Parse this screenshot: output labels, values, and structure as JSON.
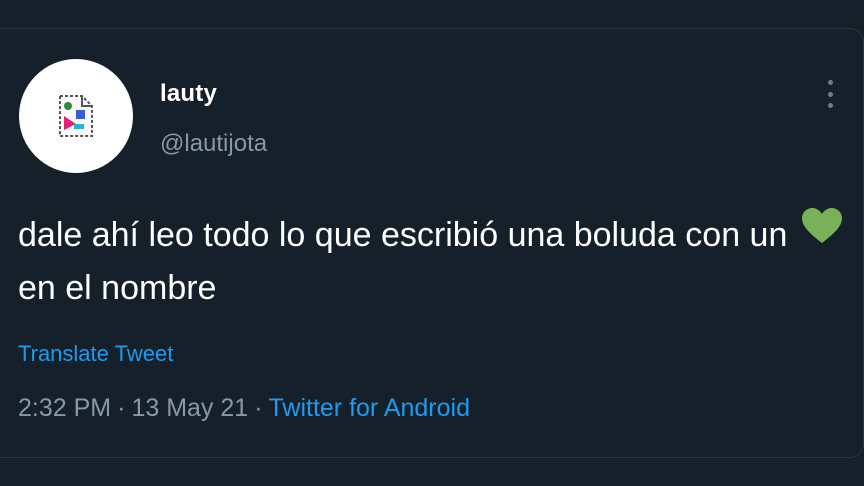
{
  "tweet": {
    "display_name": "lauty",
    "handle": "@lautijota",
    "text_before_emoji": "dale ahí leo todo lo que escribió una boluda con un",
    "emoji": "green-heart",
    "text_after_emoji": "en el nombre",
    "translate_label": "Translate Tweet",
    "time": "2:32 PM",
    "separator": "·",
    "date": "13 May 21",
    "source": "Twitter for Android"
  },
  "colors": {
    "background": "#15202b",
    "primary_text": "#ffffff",
    "secondary_text": "#8899a6",
    "accent": "#1d9bf0",
    "heart": "#78b159"
  },
  "icons": {
    "avatar": "broken-image-icon",
    "menu": "more-options-icon"
  }
}
